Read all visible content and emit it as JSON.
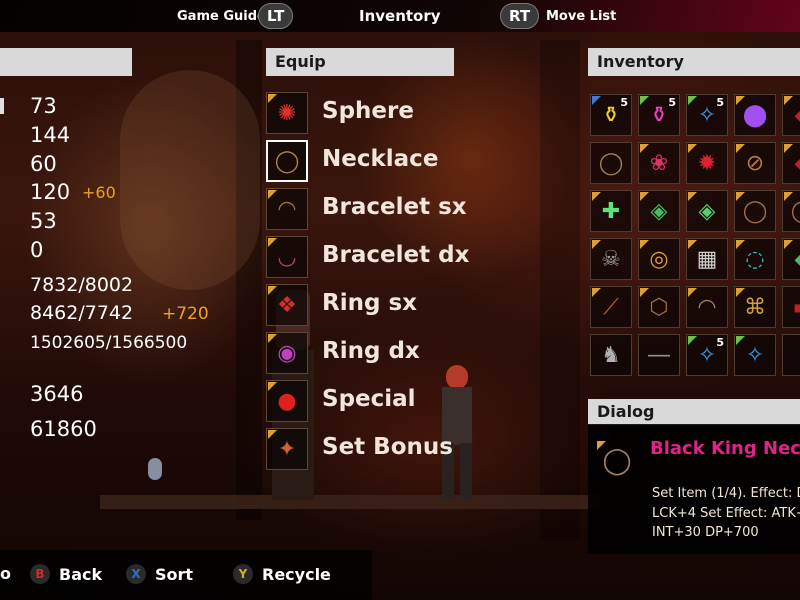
{
  "top_bar": {
    "left_label": "Game Guide",
    "left_button": "LT",
    "center_label": "Inventory",
    "right_button": "RT",
    "right_label": "Move List"
  },
  "stats_panel": {
    "header": "",
    "values": [
      "73",
      "144",
      "60",
      "120",
      "53",
      "0",
      "7832/8002",
      "8462/7742",
      "1502605/1566500",
      "3646",
      "61860"
    ],
    "bonus_atk": "+60",
    "bonus_hp": "+720"
  },
  "equip_panel": {
    "header": "Equip",
    "slots": [
      {
        "label": "Sphere",
        "icon": "sphere-icon"
      },
      {
        "label": "Necklace",
        "icon": "necklace-icon"
      },
      {
        "label": "Bracelet sx",
        "icon": "bracelet-icon"
      },
      {
        "label": "Bracelet dx",
        "icon": "bracelet-icon"
      },
      {
        "label": "Ring sx",
        "icon": "ring-icon"
      },
      {
        "label": "Ring dx",
        "icon": "ring-icon"
      },
      {
        "label": "Special",
        "icon": "special-icon"
      },
      {
        "label": "Set Bonus",
        "icon": "set-bonus-icon"
      }
    ],
    "selected_index": 1
  },
  "inventory_panel": {
    "header": "Inventory",
    "items": [
      {
        "icon": "potion-yellow-icon",
        "count": "5",
        "corner": "blue"
      },
      {
        "icon": "potion-pink-icon",
        "count": "5",
        "corner": "green"
      },
      {
        "icon": "scroll-blue-icon",
        "count": "5",
        "corner": "green"
      },
      {
        "icon": "orb-purple-icon",
        "count": "",
        "corner": "gold"
      },
      {
        "icon": "necklace-icon",
        "count": "",
        "corner": "gold"
      },
      {
        "icon": "gem-pink-icon",
        "count": "",
        "corner": "gold"
      },
      {
        "icon": "gem-red-icon",
        "count": "",
        "corner": "gold"
      },
      {
        "icon": "bracelet-icon",
        "count": "",
        "corner": "gold"
      },
      {
        "icon": "amulet-cross-icon",
        "count": "",
        "corner": "gold"
      },
      {
        "icon": "amulet-green-icon",
        "count": "",
        "corner": "gold"
      },
      {
        "icon": "amulet-green-icon",
        "count": "",
        "corner": "gold"
      },
      {
        "icon": "necklace-icon",
        "count": "",
        "corner": "gold"
      },
      {
        "icon": "skull-icon",
        "count": "",
        "corner": "gold"
      },
      {
        "icon": "ring-gold-icon",
        "count": "",
        "corner": "gold"
      },
      {
        "icon": "map-icon",
        "count": "",
        "corner": "gold"
      },
      {
        "icon": "necklace-teal-icon",
        "count": "",
        "corner": "gold"
      },
      {
        "icon": "scroll-icon",
        "count": "",
        "corner": "gold"
      },
      {
        "icon": "bracelet-icon",
        "count": "",
        "corner": "gold"
      },
      {
        "icon": "necklace-icon",
        "count": "",
        "corner": "gold"
      },
      {
        "icon": "bracelet-gold-icon",
        "count": "",
        "corner": "gold"
      },
      {
        "icon": "beast-icon",
        "count": "",
        "corner": "gold"
      },
      {
        "icon": "sword-icon",
        "count": "",
        "corner": "gold"
      },
      {
        "icon": "scroll-blue-icon",
        "count": "5",
        "corner": "green"
      },
      {
        "icon": "scroll-blue-icon",
        "count": "",
        "corner": "green"
      }
    ]
  },
  "dialog_panel": {
    "header": "Dialog",
    "item_name": "Black King Neck",
    "lines": [
      "Set Item (1/4). Effect: D",
      "LCK+4 Set Effect: ATK+",
      "INT+30 DP+700"
    ]
  },
  "bottom_bar": {
    "partial_label": "o",
    "actions": [
      {
        "button": "B",
        "label": "Back",
        "color": "#d02a2a"
      },
      {
        "button": "X",
        "label": "Sort",
        "color": "#2f6fd0"
      },
      {
        "button": "Y",
        "label": "Recycle",
        "color": "#d0b020"
      }
    ]
  },
  "colors": {
    "accent_magenta": "#e0228a",
    "bonus_orange": "#f0a020",
    "header_bg": "#d9d9d9"
  }
}
